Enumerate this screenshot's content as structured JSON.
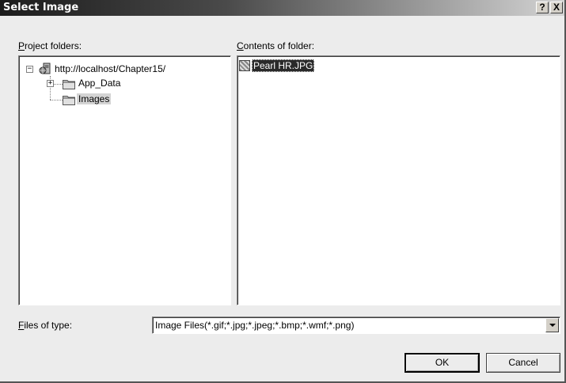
{
  "window": {
    "title": "Select Image",
    "help_label": "?",
    "close_label": "X"
  },
  "project_folders": {
    "label_accel": "P",
    "label_rest": "roject folders:",
    "tree": {
      "root": "http://localhost/Chapter15/",
      "root_expander": "−",
      "children": [
        {
          "label": "App_Data",
          "expander": "+"
        },
        {
          "label": "Images",
          "selected": true
        }
      ]
    }
  },
  "contents": {
    "label_accel": "C",
    "label_rest": "ontents of folder:",
    "files": [
      {
        "name": "Pearl HR.JPG",
        "selected": true
      }
    ]
  },
  "files_of_type": {
    "label_accel": "F",
    "label_rest": "iles of type:",
    "selected_value": "Image Files(*.gif;*.jpg;*.jpeg;*.bmp;*.wmf;*.png)"
  },
  "buttons": {
    "ok": "OK",
    "cancel": "Cancel"
  },
  "icons": {
    "root": "web-server-icon",
    "folder": "folder-icon",
    "file": "image-file-icon",
    "dropdown": "chevron-down-icon"
  }
}
